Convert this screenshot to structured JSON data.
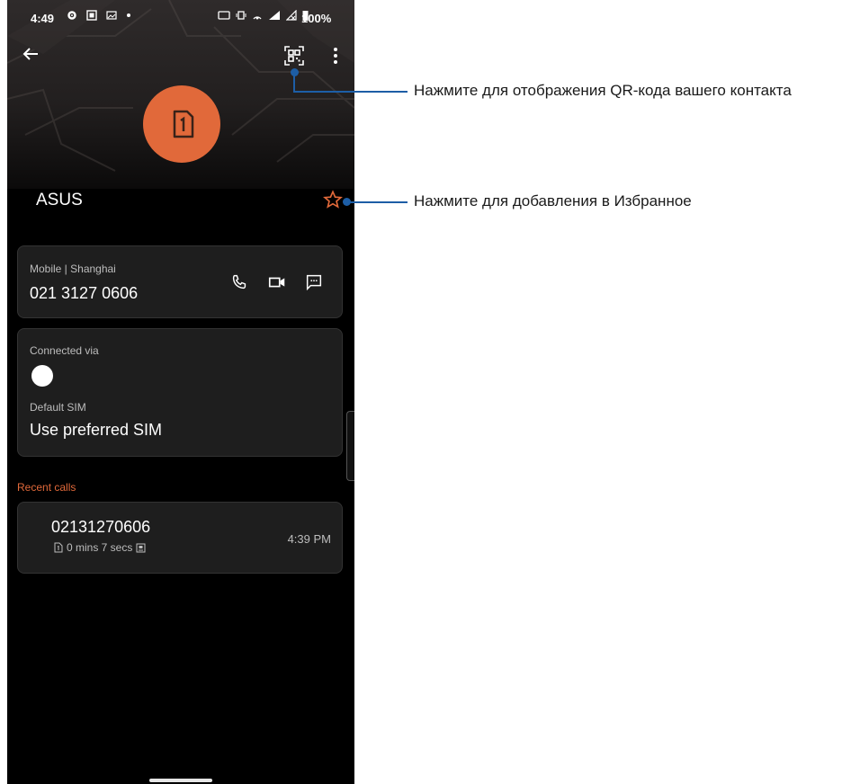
{
  "status_bar": {
    "time": "4:49",
    "battery_text": "100%"
  },
  "contact": {
    "name": "ASUS",
    "avatar_icon": "sim-card-1-icon"
  },
  "phone_card": {
    "type_label": "Mobile | Shanghai",
    "number": "021 3127 0606",
    "actions": [
      "call-icon",
      "video-call-icon",
      "message-icon"
    ]
  },
  "sim_card": {
    "connected_label": "Connected via",
    "default_label": "Default SIM",
    "default_value": "Use preferred SIM"
  },
  "recent_calls": {
    "header": "Recent calls",
    "items": [
      {
        "number": "02131270606",
        "duration": "0 mins 7 secs",
        "time": "4:39 PM"
      }
    ]
  },
  "callouts": {
    "qr": "Нажмите для отображения QR-кода вашего контакта",
    "favorite": "Нажмите для добавления в Избранное"
  },
  "colors": {
    "accent": "#e1693a",
    "callout_line": "#1d5ea6",
    "card_bg": "#1e1e1e"
  }
}
